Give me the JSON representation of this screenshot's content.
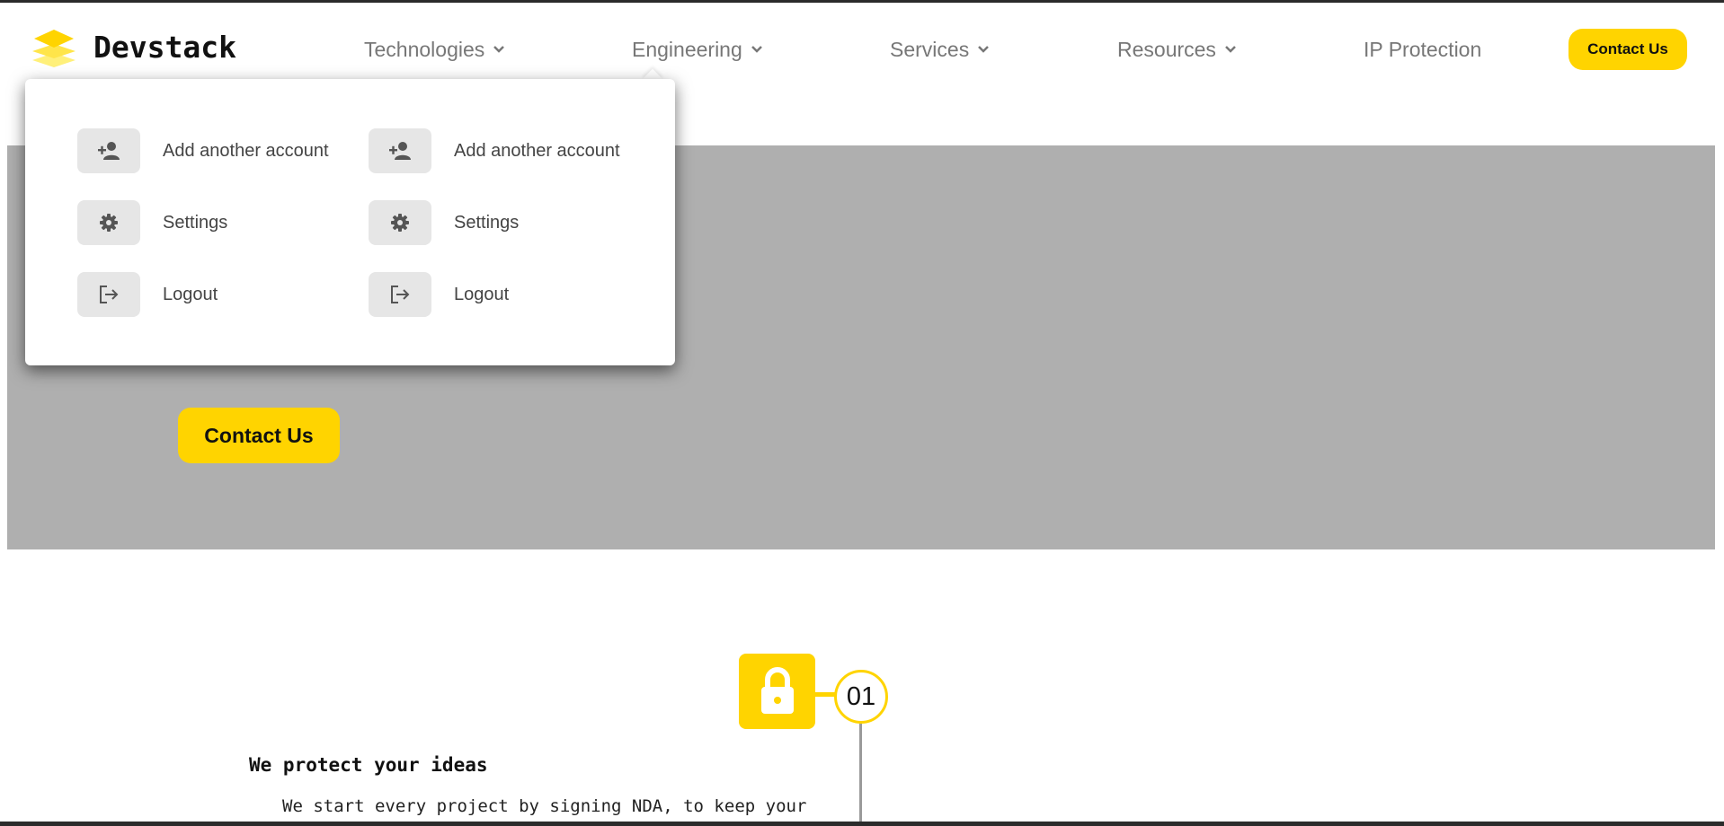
{
  "header": {
    "brand": "Devstack",
    "nav": [
      {
        "label": "Technologies",
        "has_dropdown": true
      },
      {
        "label": "Engineering",
        "has_dropdown": true
      },
      {
        "label": "Services",
        "has_dropdown": true
      },
      {
        "label": "Resources",
        "has_dropdown": true
      },
      {
        "label": "IP Protection",
        "has_dropdown": false
      }
    ],
    "cta": "Contact Us",
    "icons": {
      "logo": "stacked-layers-logo",
      "chevron": "chevron-down-icon"
    }
  },
  "dropdown": {
    "columns": [
      [
        {
          "label": "Add another account",
          "icon": "add-user-icon"
        },
        {
          "label": "Settings",
          "icon": "gear-icon"
        },
        {
          "label": "Logout",
          "icon": "logout-icon"
        }
      ],
      [
        {
          "label": "Add another account",
          "icon": "add-user-icon"
        },
        {
          "label": "Settings",
          "icon": "gear-icon"
        },
        {
          "label": "Logout",
          "icon": "logout-icon"
        }
      ]
    ]
  },
  "hero": {
    "cta": "Contact Us"
  },
  "feature": {
    "number": "01",
    "title": "We protect your ideas",
    "text": "We start every project by signing NDA, to keep your",
    "icon": "lock-icon"
  },
  "colors": {
    "accent": "#ffd400",
    "hero_bg": "#afafaf",
    "nav_text": "#777777",
    "icon_bg": "#e6e6e6"
  }
}
